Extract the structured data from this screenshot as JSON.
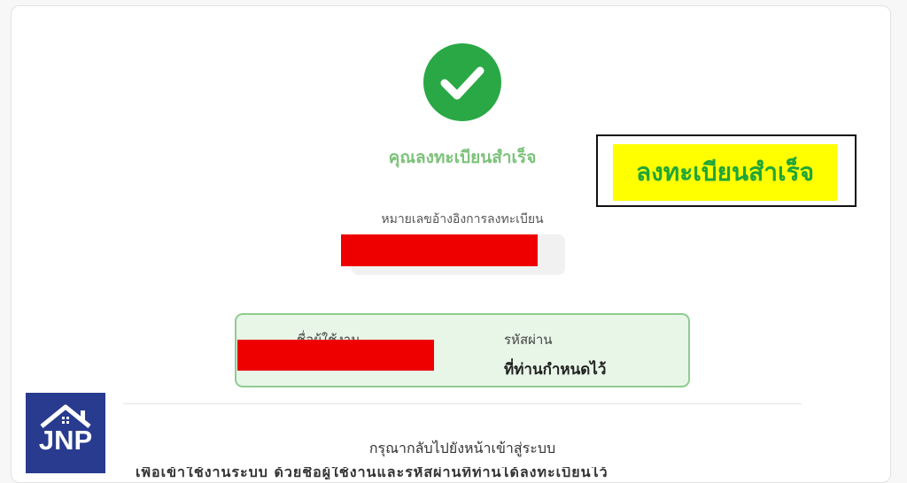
{
  "success": {
    "title": "คุณลงทะเบียนสำเร็จ",
    "icon": "check-circle-icon",
    "color": "#2aa845"
  },
  "annotation": {
    "text": "ลงทะเบียนสำเร็จ",
    "highlight_color": "#ffff00",
    "text_color": "#1fa53a"
  },
  "reference": {
    "label": "หมายเลขอ้างอิงการลงทะเบียน"
  },
  "credentials": {
    "username_label": "ชื่อผู้ใช้งาน",
    "password_label": "รหัสผ่าน",
    "password_value": "ที่ท่านกำหนดไว้"
  },
  "footer": {
    "return_text": "กรุณากลับไปยังหน้าเข้าสู่ระบบ",
    "cutoff_text": "เพื่อเข้าใช้งานระบบ ด้วยชื่อผู้ใช้งานและรหัสผ่านที่ท่านได้ลงทะเบียนไว้"
  },
  "logo": {
    "text": "JNP",
    "background": "#283b8f"
  }
}
